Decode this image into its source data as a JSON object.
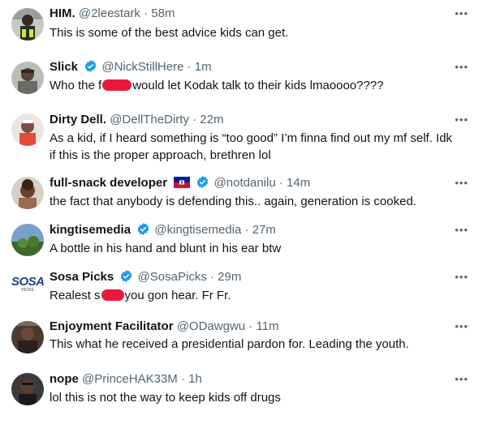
{
  "tweets": [
    {
      "name": "HIM.",
      "handle": "@2leestark",
      "time": "58m",
      "text": "This is some of the best advice kids can get.",
      "avatar": "avatar-him"
    },
    {
      "name": "Slick",
      "handle": "@NickStillHere",
      "time": "1m",
      "text_a": "Who the f",
      "text_b": "would let Kodak talk to their kids lmaoooo????",
      "verified": true,
      "avatar": "avatar-slick"
    },
    {
      "name": "Dirty Dell.",
      "handle": "@DellTheDirty",
      "time": "22m",
      "text_line1": "As a kid, if I heard something is “too good” I’m finna find out my mf self. Idk",
      "text_line2": "if this is the proper approach, brethren lol",
      "avatar": "avatar-dirty-dell"
    },
    {
      "name": "full-snack developer",
      "handle": "@notdanilu",
      "time": "14m",
      "text": "the fact that anybody is defending this.. again, generation is cooked.",
      "verified": true,
      "flag": "haiti-flag-icon",
      "avatar": "avatar-full-snack"
    },
    {
      "name": "kingtisemedia",
      "handle": "@kingtisemedia",
      "time": "27m",
      "text": "A bottle in his hand and blunt in his ear btw",
      "verified": true,
      "avatar": "avatar-kingtise"
    },
    {
      "name": "Sosa Picks",
      "handle": "@SosaPicks",
      "time": "29m",
      "text_a": "Realest s",
      "text_b": "you gon hear. Fr Fr.",
      "verified": true,
      "avatar": "avatar-sosa",
      "logo_text": "SOSA",
      "logo_sub": "PICKS"
    },
    {
      "name": "Enjoyment Facilitator",
      "handle": "@ODawgwu",
      "time": "11m",
      "text": "This what he received a presidential pardon for. Leading the youth.",
      "avatar": "avatar-enjoyment"
    },
    {
      "name": "nope",
      "handle": "@PrinceHAK33M",
      "time": "1h",
      "text": "lol this is not the way to keep kids off drugs",
      "avatar": "avatar-nope"
    }
  ],
  "separator": "·",
  "more_label": "•••",
  "colors": {
    "verified": "#1d9bf0",
    "secondary_text": "#536471",
    "censor_blur": "#e8193c"
  }
}
